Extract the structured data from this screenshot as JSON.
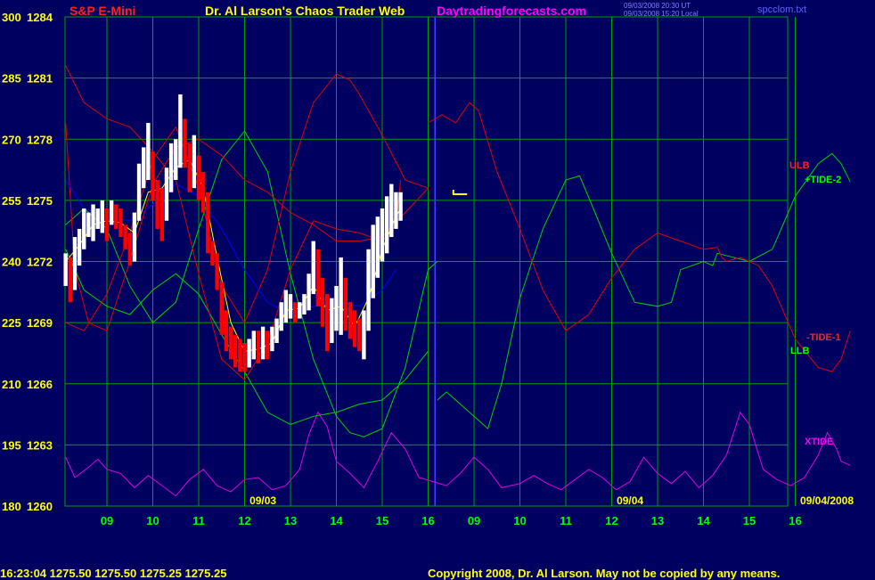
{
  "header": {
    "instrument": "S&P E-Mini",
    "title": "Dr. Al Larson's Chaos Trader Web",
    "site": "Daytradingforecasts.com",
    "update_line1": "09/03/2008 20:30 UT",
    "update_line2": "09/03/2008 15:20 Local",
    "file": "spcclom.txt"
  },
  "footer": {
    "quote": "16:23:04  1275.50 1275.50 1275.25 1275.25",
    "copyright": "Copyright 2008, Dr. Al Larson. May not be copied by any means."
  },
  "colors": {
    "background": "#000060",
    "grid": "#00a000",
    "price_up": "#ffffff",
    "price_down": "#ff0000",
    "avg_fast": "#ffff00",
    "avg_slow": "#0000ff",
    "red_line": "#e00000",
    "green_line": "#00d000",
    "xtide": "#e000e0",
    "now_line": "#4040ff"
  },
  "chart_data": {
    "type": "line",
    "xlabel": "",
    "ylabel": "",
    "grid": true,
    "y_ticks_left": [
      "300",
      "285",
      "270",
      "255",
      "240",
      "225",
      "210",
      "195",
      "180"
    ],
    "y_ticks_price": [
      "1284",
      "1281",
      "1278",
      "1275",
      "1272",
      "1269",
      "1266",
      "1263",
      "1260"
    ],
    "ylim": [
      1260,
      1284
    ],
    "x_ticks": [
      "09",
      "10",
      "11",
      "12",
      "13",
      "14",
      "15",
      "16",
      "09",
      "10",
      "11",
      "12",
      "13",
      "14",
      "15",
      "16"
    ],
    "date_labels": [
      "09/03",
      "09/04",
      "09/04/2008"
    ],
    "now_marker_hour_index": 7.15,
    "legend": [
      {
        "name": "ULB",
        "color": "#ff2020"
      },
      {
        "name": "+TIDE-2",
        "color": "#00ff00"
      },
      {
        "name": "-TIDE-1",
        "color": "#ff2020"
      },
      {
        "name": "LLB",
        "color": "#00ff00"
      },
      {
        "name": "XTIDE",
        "color": "#ff00ff"
      }
    ],
    "price_bars": [
      [
        -0.9,
        1270.8,
        1272.4
      ],
      [
        -0.8,
        1270.0,
        1272.2
      ],
      [
        -0.7,
        1270.6,
        1273.2
      ],
      [
        -0.6,
        1271.8,
        1273.6
      ],
      [
        -0.5,
        1272.6,
        1274.6
      ],
      [
        -0.4,
        1273.2,
        1274.4
      ],
      [
        -0.3,
        1273.0,
        1274.8
      ],
      [
        -0.2,
        1273.6,
        1274.6
      ],
      [
        -0.1,
        1273.4,
        1275.0
      ],
      [
        0.0,
        1273.0,
        1274.6
      ],
      [
        0.1,
        1273.8,
        1275.0
      ],
      [
        0.2,
        1273.6,
        1274.8
      ],
      [
        0.3,
        1273.2,
        1274.6
      ],
      [
        0.4,
        1272.6,
        1273.8
      ],
      [
        0.5,
        1271.8,
        1273.4
      ],
      [
        0.6,
        1272.0,
        1274.4
      ],
      [
        0.7,
        1274.0,
        1276.8
      ],
      [
        0.8,
        1275.6,
        1277.6
      ],
      [
        0.9,
        1276.0,
        1278.8
      ],
      [
        1.0,
        1275.0,
        1277.4
      ],
      [
        1.1,
        1273.6,
        1276.0
      ],
      [
        1.2,
        1273.0,
        1275.6
      ],
      [
        1.3,
        1274.0,
        1276.6
      ],
      [
        1.4,
        1275.4,
        1277.8
      ],
      [
        1.5,
        1276.0,
        1278.0
      ],
      [
        1.6,
        1276.6,
        1280.2
      ],
      [
        1.7,
        1276.6,
        1279.0
      ],
      [
        1.8,
        1275.4,
        1277.8
      ],
      [
        1.9,
        1275.6,
        1278.2
      ],
      [
        2.0,
        1275.0,
        1277.2
      ],
      [
        2.1,
        1274.4,
        1276.4
      ],
      [
        2.2,
        1272.4,
        1275.4
      ],
      [
        2.3,
        1271.8,
        1273.0
      ],
      [
        2.4,
        1270.6,
        1272.4
      ],
      [
        2.5,
        1268.4,
        1271.0
      ],
      [
        2.6,
        1267.6,
        1269.6
      ],
      [
        2.7,
        1267.2,
        1268.8
      ],
      [
        2.8,
        1266.8,
        1268.4
      ],
      [
        2.9,
        1266.6,
        1268.2
      ],
      [
        3.0,
        1266.6,
        1268.0
      ],
      [
        3.1,
        1266.8,
        1268.2
      ],
      [
        3.2,
        1267.2,
        1268.6
      ],
      [
        3.3,
        1267.0,
        1268.6
      ],
      [
        3.4,
        1267.2,
        1268.8
      ],
      [
        3.5,
        1267.2,
        1268.6
      ],
      [
        3.6,
        1267.6,
        1268.8
      ],
      [
        3.7,
        1268.0,
        1269.2
      ],
      [
        3.8,
        1268.6,
        1270.0
      ],
      [
        3.9,
        1269.0,
        1270.6
      ],
      [
        4.0,
        1269.2,
        1270.4
      ],
      [
        4.1,
        1269.0,
        1270.0
      ],
      [
        4.2,
        1269.2,
        1270.0
      ],
      [
        4.3,
        1269.4,
        1270.4
      ],
      [
        4.4,
        1269.6,
        1271.4
      ],
      [
        4.5,
        1270.4,
        1273.0
      ],
      [
        4.6,
        1269.8,
        1272.6
      ],
      [
        4.7,
        1268.8,
        1271.2
      ],
      [
        4.8,
        1267.6,
        1270.4
      ],
      [
        4.9,
        1268.0,
        1270.2
      ],
      [
        5.0,
        1268.6,
        1270.8
      ],
      [
        5.1,
        1268.4,
        1272.2
      ],
      [
        5.2,
        1268.6,
        1271.2
      ],
      [
        5.3,
        1268.2,
        1270.0
      ],
      [
        5.4,
        1267.8,
        1269.6
      ],
      [
        5.5,
        1267.6,
        1269.2
      ],
      [
        5.6,
        1267.2,
        1269.6
      ],
      [
        5.7,
        1268.6,
        1272.6
      ],
      [
        5.8,
        1270.2,
        1273.8
      ],
      [
        5.9,
        1271.2,
        1274.2
      ],
      [
        6.0,
        1272.0,
        1274.6
      ],
      [
        6.1,
        1272.4,
        1275.2
      ],
      [
        6.2,
        1273.2,
        1275.8
      ],
      [
        6.3,
        1273.6,
        1275.4
      ],
      [
        6.4,
        1274.0,
        1275.4
      ]
    ],
    "avg_fast": [
      [
        -0.9,
        1272.0
      ],
      [
        -0.6,
        1272.8
      ],
      [
        -0.3,
        1273.8
      ],
      [
        0.0,
        1274.0
      ],
      [
        0.3,
        1273.9
      ],
      [
        0.6,
        1273.4
      ],
      [
        0.9,
        1275.4
      ],
      [
        1.2,
        1275.6
      ],
      [
        1.5,
        1276.6
      ],
      [
        1.8,
        1277.0
      ],
      [
        2.1,
        1275.6
      ],
      [
        2.4,
        1272.2
      ],
      [
        2.7,
        1269.0
      ],
      [
        3.0,
        1267.6
      ],
      [
        3.3,
        1267.7
      ],
      [
        3.6,
        1268.0
      ],
      [
        3.9,
        1269.6
      ],
      [
        4.2,
        1269.7
      ],
      [
        4.5,
        1270.8
      ],
      [
        4.8,
        1269.6
      ],
      [
        5.1,
        1269.8
      ],
      [
        5.4,
        1268.8
      ],
      [
        5.7,
        1270.2
      ],
      [
        6.0,
        1272.6
      ],
      [
        6.3,
        1274.2
      ],
      [
        6.4,
        1274.6
      ]
    ],
    "avg_slow": [
      [
        -0.9,
        1276.0
      ],
      [
        -0.5,
        1274.6
      ],
      [
        0.0,
        1274.2
      ],
      [
        0.5,
        1274.0
      ],
      [
        1.0,
        1274.8
      ],
      [
        1.5,
        1275.8
      ],
      [
        2.0,
        1275.2
      ],
      [
        2.5,
        1273.6
      ],
      [
        3.0,
        1271.6
      ],
      [
        3.5,
        1270.0
      ],
      [
        4.0,
        1269.4
      ],
      [
        4.5,
        1269.8
      ],
      [
        5.0,
        1270.0
      ],
      [
        5.5,
        1269.8
      ],
      [
        6.0,
        1270.6
      ],
      [
        6.3,
        1271.6
      ]
    ],
    "red_upper": [
      [
        -0.9,
        1281.6
      ],
      [
        -0.5,
        1279.8
      ],
      [
        0.0,
        1279.0
      ],
      [
        0.5,
        1278.6
      ],
      [
        1.0,
        1277.4
      ],
      [
        1.5,
        1276.0
      ],
      [
        2.0,
        1271.4
      ],
      [
        2.5,
        1267.2
      ],
      [
        3.0,
        1266.2
      ],
      [
        3.5,
        1268.0
      ],
      [
        4.0,
        1271.6
      ],
      [
        4.5,
        1274.0
      ],
      [
        5.0,
        1273.6
      ],
      [
        5.5,
        1273.4
      ],
      [
        6.0,
        1273.0
      ],
      [
        6.3,
        1273.8
      ],
      [
        6.4,
        1276.0
      ]
    ],
    "red_middle": [
      [
        -0.9,
        1278.8
      ],
      [
        -0.7,
        1271.6
      ],
      [
        -0.4,
        1269.0
      ],
      [
        0.0,
        1268.6
      ],
      [
        0.5,
        1272.0
      ],
      [
        1.0,
        1275.8
      ],
      [
        1.5,
        1277.6
      ],
      [
        2.0,
        1278.0
      ],
      [
        2.5,
        1277.2
      ],
      [
        3.0,
        1276.0
      ],
      [
        3.5,
        1275.4
      ],
      [
        4.0,
        1274.4
      ],
      [
        4.5,
        1273.8
      ],
      [
        5.0,
        1273.0
      ],
      [
        5.5,
        1273.0
      ],
      [
        6.0,
        1273.2
      ],
      [
        6.5,
        1274.4
      ],
      [
        7.0,
        1275.6
      ]
    ],
    "red_lower": [
      [
        -0.9,
        1269.0
      ],
      [
        -0.5,
        1268.6
      ],
      [
        0.0,
        1270.4
      ],
      [
        0.5,
        1273.4
      ],
      [
        1.0,
        1277.0
      ],
      [
        1.5,
        1278.6
      ],
      [
        2.0,
        1275.6
      ],
      [
        2.5,
        1270.8
      ],
      [
        3.0,
        1269.0
      ],
      [
        3.5,
        1271.6
      ],
      [
        4.0,
        1276.4
      ],
      [
        4.5,
        1279.8
      ],
      [
        5.0,
        1281.2
      ],
      [
        5.3,
        1280.9
      ],
      [
        5.5,
        1280.2
      ],
      [
        6.0,
        1278.2
      ],
      [
        6.5,
        1276.0
      ],
      [
        7.0,
        1275.6
      ]
    ],
    "red_future": [
      [
        7.0,
        1278.8
      ],
      [
        7.3,
        1279.2
      ],
      [
        7.6,
        1278.8
      ],
      [
        7.9,
        1279.8
      ],
      [
        8.1,
        1279.4
      ],
      [
        8.5,
        1276.4
      ],
      [
        9.0,
        1273.6
      ],
      [
        9.5,
        1270.6
      ],
      [
        10.0,
        1268.6
      ],
      [
        10.5,
        1269.4
      ],
      [
        11.0,
        1271.2
      ],
      [
        11.5,
        1272.6
      ],
      [
        12.0,
        1273.4
      ],
      [
        12.5,
        1273.0
      ],
      [
        13.0,
        1272.6
      ],
      [
        13.3,
        1272.7
      ],
      [
        13.4,
        1272.2
      ],
      [
        13.5,
        1272.0
      ],
      [
        13.8,
        1272.2
      ],
      [
        14.2,
        1271.8
      ],
      [
        14.5,
        1270.8
      ],
      [
        15.0,
        1268.2
      ],
      [
        15.5,
        1266.8
      ],
      [
        15.8,
        1266.6
      ],
      [
        16.0,
        1267.2
      ],
      [
        16.2,
        1268.6
      ]
    ],
    "green_upper": [
      [
        -0.9,
        1273.8
      ],
      [
        -0.5,
        1274.6
      ],
      [
        0.0,
        1273.6
      ],
      [
        0.5,
        1270.8
      ],
      [
        1.0,
        1269.0
      ],
      [
        1.5,
        1270.0
      ],
      [
        2.0,
        1273.6
      ],
      [
        2.5,
        1277.0
      ],
      [
        3.0,
        1278.4
      ],
      [
        3.5,
        1276.4
      ],
      [
        4.0,
        1271.4
      ],
      [
        4.5,
        1267.2
      ],
      [
        5.0,
        1264.4
      ],
      [
        5.3,
        1263.6
      ],
      [
        5.6,
        1263.4
      ],
      [
        6.0,
        1263.8
      ],
      [
        6.5,
        1266.8
      ],
      [
        7.0,
        1271.6
      ],
      [
        7.2,
        1272.0
      ]
    ],
    "green_lower": [
      [
        -0.9,
        1272.6
      ],
      [
        -0.5,
        1270.6
      ],
      [
        0.0,
        1269.8
      ],
      [
        0.5,
        1269.4
      ],
      [
        1.0,
        1270.6
      ],
      [
        1.5,
        1271.4
      ],
      [
        2.0,
        1270.4
      ],
      [
        2.5,
        1268.4
      ],
      [
        3.0,
        1266.6
      ],
      [
        3.5,
        1264.6
      ],
      [
        4.0,
        1264.0
      ],
      [
        4.5,
        1264.4
      ],
      [
        5.0,
        1264.6
      ],
      [
        5.5,
        1265.0
      ],
      [
        6.0,
        1265.2
      ],
      [
        6.5,
        1266.2
      ],
      [
        7.0,
        1267.6
      ]
    ],
    "green_future": [
      [
        7.2,
        1265.2
      ],
      [
        7.4,
        1265.6
      ],
      [
        7.6,
        1265.2
      ],
      [
        8.0,
        1264.4
      ],
      [
        8.3,
        1263.8
      ],
      [
        8.6,
        1266.0
      ],
      [
        9.0,
        1270.2
      ],
      [
        9.5,
        1273.6
      ],
      [
        10.0,
        1276.0
      ],
      [
        10.3,
        1276.2
      ],
      [
        10.6,
        1274.6
      ],
      [
        11.0,
        1272.4
      ],
      [
        11.5,
        1270.0
      ],
      [
        12.0,
        1269.8
      ],
      [
        12.3,
        1270.0
      ],
      [
        12.5,
        1271.6
      ],
      [
        13.0,
        1272.0
      ],
      [
        13.2,
        1271.8
      ],
      [
        13.3,
        1272.4
      ],
      [
        14.0,
        1272.0
      ],
      [
        14.5,
        1272.6
      ],
      [
        15.0,
        1275.2
      ],
      [
        15.5,
        1276.8
      ],
      [
        15.8,
        1277.3
      ],
      [
        16.0,
        1276.8
      ],
      [
        16.2,
        1275.9
      ]
    ],
    "xtide": [
      [
        -0.9,
        1262.4
      ],
      [
        -0.7,
        1261.4
      ],
      [
        -0.4,
        1261.9
      ],
      [
        -0.2,
        1262.3
      ],
      [
        0.0,
        1261.8
      ],
      [
        0.3,
        1261.6
      ],
      [
        0.6,
        1260.9
      ],
      [
        0.9,
        1261.5
      ],
      [
        1.2,
        1261.0
      ],
      [
        1.5,
        1260.5
      ],
      [
        1.8,
        1261.3
      ],
      [
        2.1,
        1261.8
      ],
      [
        2.4,
        1261.0
      ],
      [
        2.7,
        1260.7
      ],
      [
        3.0,
        1261.3
      ],
      [
        3.3,
        1261.4
      ],
      [
        3.6,
        1260.8
      ],
      [
        3.9,
        1261.0
      ],
      [
        4.2,
        1261.8
      ],
      [
        4.4,
        1263.5
      ],
      [
        4.6,
        1264.6
      ],
      [
        4.8,
        1263.9
      ],
      [
        5.0,
        1262.2
      ],
      [
        5.3,
        1261.6
      ],
      [
        5.6,
        1260.9
      ],
      [
        5.9,
        1262.2
      ],
      [
        6.2,
        1263.6
      ],
      [
        6.5,
        1262.8
      ],
      [
        6.8,
        1261.4
      ],
      [
        7.1,
        1261.2
      ],
      [
        7.4,
        1261.0
      ],
      [
        7.7,
        1261.6
      ],
      [
        8.0,
        1262.4
      ],
      [
        8.3,
        1261.8
      ],
      [
        8.6,
        1260.9
      ],
      [
        9.0,
        1261.1
      ],
      [
        9.3,
        1261.5
      ],
      [
        9.6,
        1261.1
      ],
      [
        9.9,
        1260.8
      ],
      [
        10.2,
        1261.3
      ],
      [
        10.5,
        1261.8
      ],
      [
        10.8,
        1261.4
      ],
      [
        11.1,
        1260.8
      ],
      [
        11.4,
        1261.2
      ],
      [
        11.7,
        1262.4
      ],
      [
        12.0,
        1261.6
      ],
      [
        12.3,
        1261.1
      ],
      [
        12.6,
        1261.7
      ],
      [
        12.9,
        1260.9
      ],
      [
        13.2,
        1261.5
      ],
      [
        13.5,
        1262.5
      ],
      [
        13.8,
        1264.6
      ],
      [
        14.0,
        1264.0
      ],
      [
        14.3,
        1261.8
      ],
      [
        14.6,
        1261.3
      ],
      [
        14.9,
        1261.0
      ],
      [
        15.2,
        1261.4
      ],
      [
        15.5,
        1262.5
      ],
      [
        15.7,
        1263.6
      ],
      [
        15.9,
        1262.8
      ],
      [
        16.0,
        1262.2
      ],
      [
        16.2,
        1262.0
      ]
    ],
    "marker_price": 1275.3
  }
}
